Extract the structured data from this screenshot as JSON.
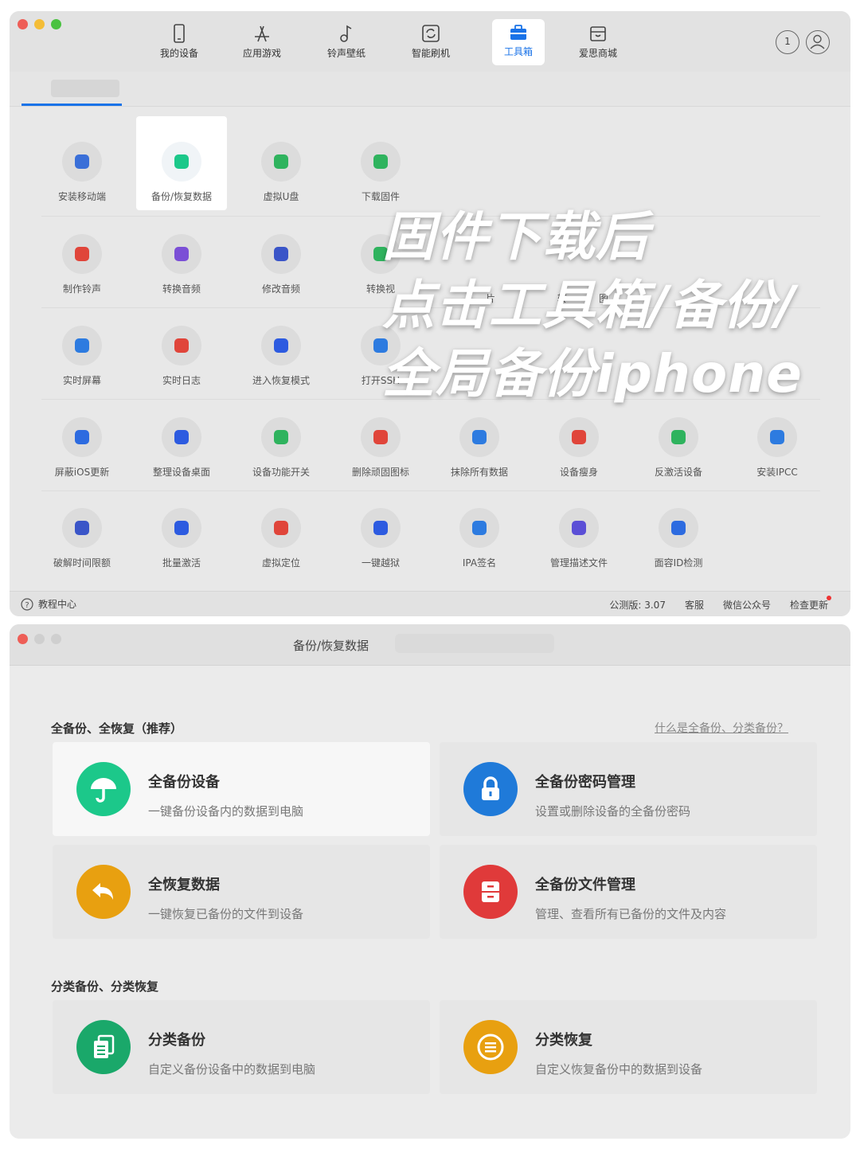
{
  "nav": {
    "items": [
      {
        "label": "我的设备",
        "icon": "phone-icon"
      },
      {
        "label": "应用游戏",
        "icon": "app-store-icon"
      },
      {
        "label": "铃声壁纸",
        "icon": "music-note-icon"
      },
      {
        "label": "智能刷机",
        "icon": "refresh-icon"
      },
      {
        "label": "工具箱",
        "icon": "toolbox-icon"
      },
      {
        "label": "爱思商城",
        "icon": "store-icon"
      }
    ],
    "active": "工具箱",
    "notification_count": "1"
  },
  "tools": [
    {
      "label": "安装移动端",
      "icon": "install-mobile-icon",
      "color": "#3a6fd8"
    },
    {
      "label": "备份/恢复数据",
      "icon": "umbrella-icon",
      "color": "#1cc88a"
    },
    {
      "label": "虚拟U盘",
      "icon": "usb-icon",
      "color": "#2fb35e"
    },
    {
      "label": "下载固件",
      "icon": "download-firmware-icon",
      "color": "#2fb35e"
    },
    {
      "label": "制作铃声",
      "icon": "ringtone-icon",
      "color": "#e0453a"
    },
    {
      "label": "转换音频",
      "icon": "audio-wave-icon",
      "color": "#7b4fd6"
    },
    {
      "label": "修改音频",
      "icon": "edit-audio-icon",
      "color": "#3a55c8"
    },
    {
      "label": "转换视",
      "icon": "convert-video-icon",
      "color": "#2fb35e"
    },
    {
      "label": "实时屏幕",
      "icon": "screen-mirror-icon",
      "color": "#2d7be0"
    },
    {
      "label": "实时日志",
      "icon": "log-icon",
      "color": "#e0453a"
    },
    {
      "label": "进入恢复模式",
      "icon": "recovery-shield-icon",
      "color": "#2d5be0"
    },
    {
      "label": "打开SSH",
      "icon": "ssh-terminal-icon",
      "color": "#2d7be0"
    },
    {
      "label": "屏蔽iOS更新",
      "icon": "gear-icon",
      "color": "#2d6be0"
    },
    {
      "label": "整理设备桌面",
      "icon": "grid-apps-icon",
      "color": "#2d5be0"
    },
    {
      "label": "设备功能开关",
      "icon": "toggle-icon",
      "color": "#2fb35e"
    },
    {
      "label": "删除顽固图标",
      "icon": "trash-icon",
      "color": "#e0453a"
    },
    {
      "label": "抹除所有数据",
      "icon": "erase-icon",
      "color": "#2d7be0"
    },
    {
      "label": "设备瘦身",
      "icon": "broom-icon",
      "color": "#e0453a"
    },
    {
      "label": "反激活设备",
      "icon": "deactivate-icon",
      "color": "#2fb35e"
    },
    {
      "label": "安装IPCC",
      "icon": "ipcc-icon",
      "color": "#2d7be0"
    },
    {
      "label": "破解时间限额",
      "icon": "hourglass-icon",
      "color": "#3a55c8"
    },
    {
      "label": "批量激活",
      "icon": "batch-activate-icon",
      "color": "#2d5be0"
    },
    {
      "label": "虚拟定位",
      "icon": "location-pin-icon",
      "color": "#e0453a"
    },
    {
      "label": "一键越狱",
      "icon": "jailbreak-icon",
      "color": "#2d5be0"
    },
    {
      "label": "IPA签名",
      "icon": "ipa-icon",
      "color": "#2d7be0"
    },
    {
      "label": "管理描述文件",
      "icon": "profile-folder-icon",
      "color": "#5b4fd6"
    },
    {
      "label": "面容ID检测",
      "icon": "face-id-icon",
      "color": "#2d6be0"
    }
  ],
  "tools_partial_labels": [
    "片",
    "转",
    "图"
  ],
  "bottombar": {
    "help": "教程中心",
    "version": "公测版: 3.07",
    "service": "客服",
    "wechat": "微信公众号",
    "update": "检查更新"
  },
  "overlay": {
    "line1": "固件下载后",
    "line2": "点击工具箱/备份/",
    "line3": "全局备份iphone"
  },
  "backup_window": {
    "title": "备份/恢复数据",
    "section1": "全备份、全恢复（推荐）",
    "help_link": "什么是全备份、分类备份？",
    "section2": "分类备份、分类恢复",
    "cards": [
      {
        "title": "全备份设备",
        "desc": "一键备份设备内的数据到电脑",
        "icon": "umbrella-icon",
        "color": "#1cc88a"
      },
      {
        "title": "全备份密码管理",
        "desc": "设置或删除设备的全备份密码",
        "icon": "lock-icon",
        "color": "#1f7ad9"
      },
      {
        "title": "全恢复数据",
        "desc": "一键恢复已备份的文件到设备",
        "icon": "restore-arrow-icon",
        "color": "#e8a010"
      },
      {
        "title": "全备份文件管理",
        "desc": "管理、查看所有已备份的文件及内容",
        "icon": "file-cabinet-icon",
        "color": "#e03a3a"
      },
      {
        "title": "分类备份",
        "desc": "自定义备份设备中的数据到电脑",
        "icon": "documents-icon",
        "color": "#1aa86a"
      },
      {
        "title": "分类恢复",
        "desc": "自定义恢复备份中的数据到设备",
        "icon": "list-restore-icon",
        "color": "#e8a010"
      }
    ]
  }
}
